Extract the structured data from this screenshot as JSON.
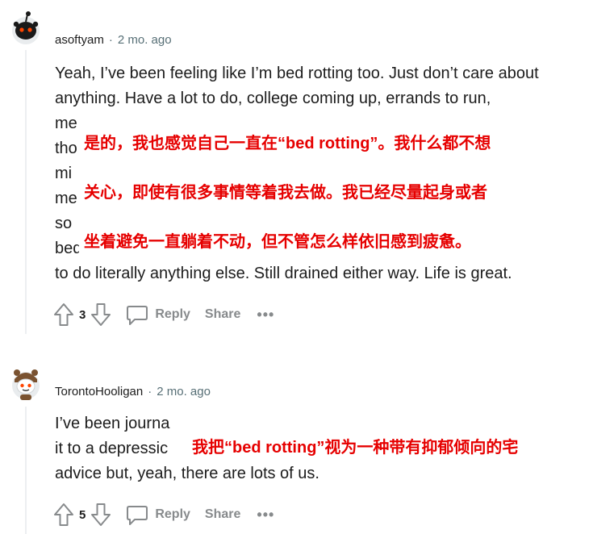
{
  "comments": [
    {
      "author": "asoftyam",
      "time": "2 mo. ago",
      "lines": [
        "Yeah, I’ve been feeling like I’m bed rotting too. Just don’t care about",
        "anything. Have a lot to do, college coming up, errands to run,",
        "me",
        "tho",
        "mi",
        "me",
        "so",
        "bed",
        "to do literally anything else. Still drained either way. Life is great."
      ],
      "translation_lines": [
        "是的，我也感觉自己一直在“bed rotting”。我什么都不想",
        "关心，即使有很多事情等着我去做。我已经尽量起身或者",
        "坐着避免一直躺着不动，但不管怎么样依旧感到疲惫。"
      ],
      "votes": "3",
      "reply_label": "Reply",
      "share_label": "Share",
      "more_label": "•••"
    },
    {
      "author": "TorontoHooligan",
      "time": "2 mo. ago",
      "lines": [
        "I’ve been journa",
        "it to a depressic",
        "advice but, yeah, there are lots of us."
      ],
      "translation_lines": [
        "我把“bed rotting”视为一种带有抑郁倾向的宅"
      ],
      "votes": "5",
      "reply_label": "Reply",
      "share_label": "Share",
      "more_label": "•••"
    }
  ],
  "colors": {
    "accent_overlay_text": "#e60000",
    "meta_text": "#576f76",
    "action_text": "#878a8c"
  },
  "icons": [
    "snoo-avatar-icon",
    "upvote-icon",
    "downvote-icon",
    "comment-bubble-icon",
    "more-icon"
  ]
}
